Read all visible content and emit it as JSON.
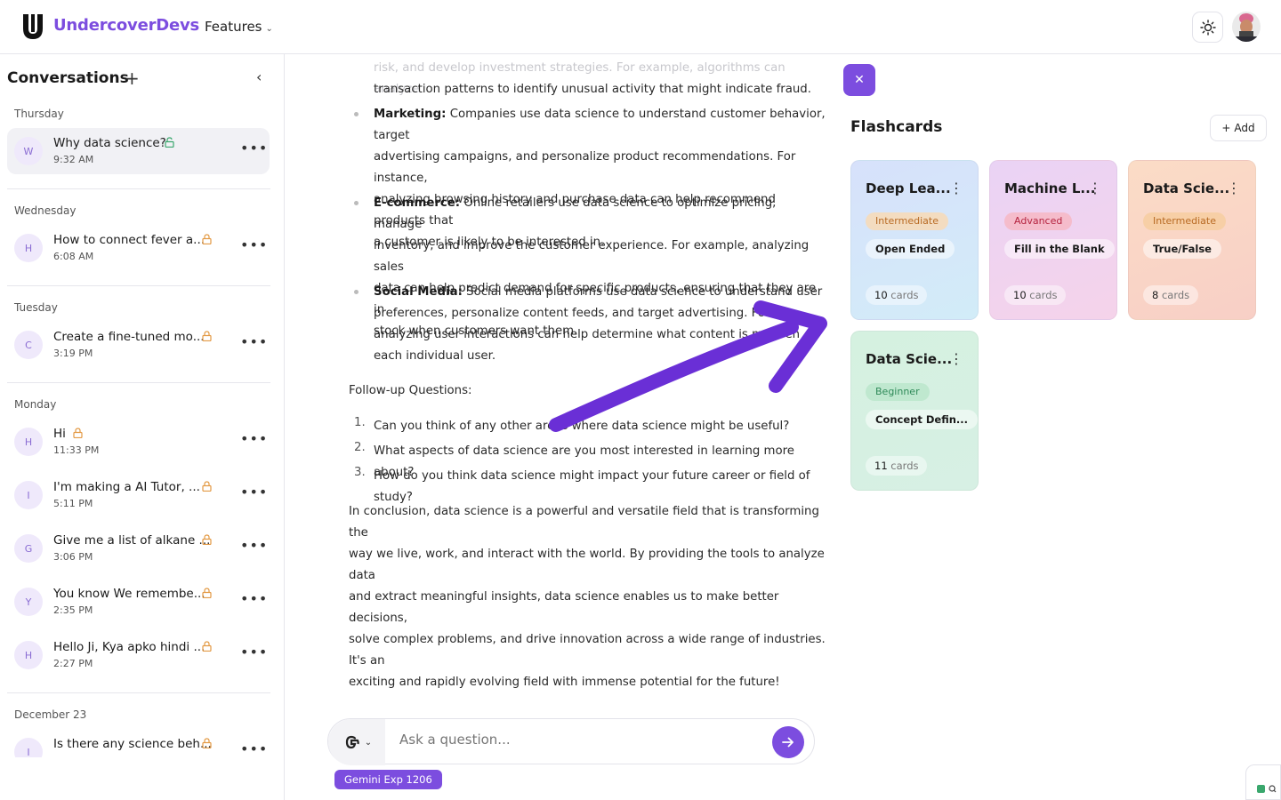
{
  "header": {
    "brand": "UndercoverDevs",
    "features_label": "Features"
  },
  "sidebar": {
    "title": "Conversations",
    "groups": [
      {
        "label": "Thursday",
        "items": [
          {
            "avatar": "W",
            "title": "Why data science?",
            "time": "9:32 AM",
            "lock": "open"
          }
        ]
      },
      {
        "label": "Wednesday",
        "items": [
          {
            "avatar": "H",
            "title": "How to connect fever a...",
            "time": "6:08 AM",
            "lock": "closed"
          }
        ]
      },
      {
        "label": "Tuesday",
        "items": [
          {
            "avatar": "C",
            "title": "Create a fine-tuned mo...",
            "time": "3:19 PM",
            "lock": "closed"
          }
        ]
      },
      {
        "label": "Monday",
        "items": [
          {
            "avatar": "H",
            "title": "Hi",
            "time": "11:33 PM",
            "lock": "closed"
          },
          {
            "avatar": "I",
            "title": "I'm making a AI Tutor, ...",
            "time": "5:11 PM",
            "lock": "closed"
          },
          {
            "avatar": "G",
            "title": "Give me a list of alkane ...",
            "time": "3:06 PM",
            "lock": "closed"
          },
          {
            "avatar": "Y",
            "title": "You know We remembe...",
            "time": "2:35 PM",
            "lock": "closed"
          },
          {
            "avatar": "H",
            "title": "Hello Ji, Kya apko hindi ...",
            "time": "2:27 PM",
            "lock": "closed"
          }
        ]
      },
      {
        "label": "December 23",
        "items": [
          {
            "avatar": "I",
            "title": "Is there any science beh...",
            "time": "",
            "lock": "closed"
          }
        ]
      }
    ]
  },
  "chat": {
    "faded_line": "risk, and develop investment strategies. For example, algorithms can analyze",
    "finance_tail": "transaction patterns to identify unusual activity that might indicate fraud.",
    "bullets": [
      {
        "label": "Marketing:",
        "lines": [
          " Companies use data science to understand customer behavior, target",
          "advertising campaigns, and personalize product recommendations. For instance,",
          "analyzing browsing history and purchase data can help recommend products that",
          "a customer is likely to be interested in."
        ]
      },
      {
        "label": "E-commerce:",
        "lines": [
          " Online retailers use data science to optimize pricing, manage",
          "inventory, and improve the customer experience. For example, analyzing sales",
          "data can help predict demand for specific products, ensuring that they are in",
          "stock when customers want them."
        ]
      },
      {
        "label": "Social Media:",
        "lines": [
          " Social media platforms use data science to understand user",
          "preferences, personalize content feeds, and target advertising. For exa",
          "analyzing user interactions can help determine what content is most en",
          "each individual user."
        ]
      }
    ],
    "followup_heading": "Follow-up Questions:",
    "questions": [
      "Can you think of any other areas where data science might be useful?",
      "What aspects of data science are you most interested in learning more about?",
      "How do you think data science might impact your future career or field of study?"
    ],
    "conclusion": [
      "In conclusion, data science is a powerful and versatile field that is transforming the",
      "way we live, work, and interact with the world. By providing the tools to analyze data",
      "and extract meaningful insights, data science enables us to make better decisions,",
      "solve complex problems, and drive innovation across a wide range of industries. It's an",
      "exciting and rapidly evolving field with immense potential for the future!"
    ],
    "input_placeholder": "Ask a question...",
    "model_badge": "Gemini Exp 1206"
  },
  "flashcards": {
    "title": "Flashcards",
    "add_label": "Add",
    "cards": [
      {
        "title": "Deep Lea...",
        "level": "Intermediate",
        "type": "Open Ended",
        "count": "10",
        "count_unit": "cards"
      },
      {
        "title": "Machine L...",
        "level": "Advanced",
        "type": "Fill in the Blank",
        "count": "10",
        "count_unit": "cards"
      },
      {
        "title": "Data Scie...",
        "level": "Intermediate",
        "type": "True/False",
        "count": "8",
        "count_unit": "cards"
      },
      {
        "title": "Data Scie...",
        "level": "Beginner",
        "type": "Concept Defin...",
        "count": "11",
        "count_unit": "cards"
      }
    ]
  },
  "colors": {
    "accent": "#7c4ddf",
    "intermediate": "#f7d8b8",
    "advanced": "#f6c4cf",
    "beginner": "#c6ecd6"
  }
}
